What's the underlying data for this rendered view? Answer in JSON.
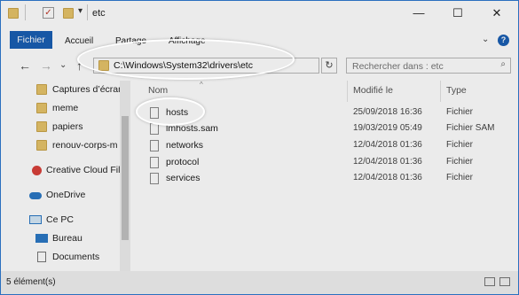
{
  "window": {
    "title": "etc"
  },
  "titlebar": {
    "minimize": "—",
    "maximize": "☐",
    "close": "✕",
    "qa_dropdown": "▾"
  },
  "ribbon": {
    "tabs": [
      "Fichier",
      "Accueil",
      "Partage",
      "Affichage"
    ],
    "collapse": "⌄",
    "help": "?"
  },
  "nav": {
    "back": "←",
    "forward": "→",
    "recent": "⌄",
    "up": "↑",
    "address": "C:\\Windows\\System32\\drivers\\etc",
    "address_dropdown": "⌄",
    "refresh": "↻",
    "search_placeholder": "Rechercher dans : etc",
    "search_icon": "⌕"
  },
  "sidebar": {
    "items": [
      {
        "label": "Captures d’écran",
        "icon": "folder-icon"
      },
      {
        "label": "meme",
        "icon": "folder-icon"
      },
      {
        "label": "papiers",
        "icon": "folder-icon"
      },
      {
        "label": "renouv-corps-m",
        "icon": "folder-icon"
      },
      {
        "label": "Creative Cloud Fil",
        "icon": "creative-cloud-icon"
      },
      {
        "label": "OneDrive",
        "icon": "onedrive-icon"
      },
      {
        "label": "Ce PC",
        "icon": "pc-icon"
      },
      {
        "label": "Bureau",
        "icon": "desktop-icon"
      },
      {
        "label": "Documents",
        "icon": "documents-icon"
      }
    ]
  },
  "files": {
    "columns": {
      "name": "Nom",
      "modified": "Modifié le",
      "type": "Type"
    },
    "rows": [
      {
        "name": "hosts",
        "modified": "25/09/2018 16:36",
        "type": "Fichier"
      },
      {
        "name": "lmhosts.sam",
        "modified": "19/03/2019 05:49",
        "type": "Fichier SAM"
      },
      {
        "name": "networks",
        "modified": "12/04/2018 01:36",
        "type": "Fichier"
      },
      {
        "name": "protocol",
        "modified": "12/04/2018 01:36",
        "type": "Fichier"
      },
      {
        "name": "services",
        "modified": "12/04/2018 01:36",
        "type": "Fichier"
      }
    ]
  },
  "status": {
    "count": "5 élément(s)"
  },
  "colors": {
    "accent": "#1a5fb4",
    "folder": "#e6c46a"
  }
}
